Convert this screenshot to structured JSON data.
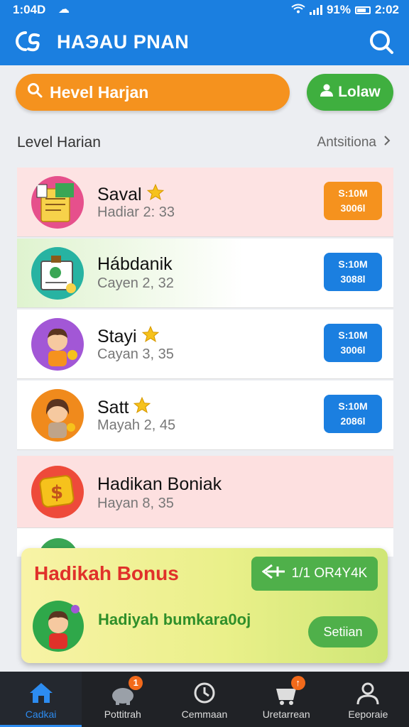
{
  "status_bar": {
    "time": "1:04D",
    "right": "91%",
    "clock": "2:02"
  },
  "app": {
    "title": "HAЭAU PNAN"
  },
  "search": {
    "label": "Hevel Harjan"
  },
  "follow": {
    "label": "Lolaw"
  },
  "section": {
    "title": "Level Harian",
    "link": "Antsitiona"
  },
  "list": [
    {
      "name": "Saval",
      "sub": "Hadiar 2: 33",
      "badge_top": "S:10M",
      "badge_bottom": "3006l",
      "badge_color": "#f5921e",
      "bg": "#fde3e3",
      "star": true
    },
    {
      "name": "Hábdanik",
      "sub": "Cayen 2, 32",
      "badge_top": "S:10M",
      "badge_bottom": "3088l",
      "badge_color": "#1b7fe0",
      "bg": "linear-gradient(90deg,#dff3cf 0%,#ffffff 60%)",
      "star": false
    },
    {
      "name": "Stayi",
      "sub": "Cayan 3, 35",
      "badge_top": "S:10M",
      "badge_bottom": "3006l",
      "badge_color": "#1b7fe0",
      "bg": "#ffffff",
      "star": true
    },
    {
      "name": "Satt",
      "sub": "Mayah 2, 45",
      "badge_top": "S:10M",
      "badge_bottom": "2086l",
      "badge_color": "#1b7fe0",
      "bg": "#ffffff",
      "star": true
    },
    {
      "name": "Hadikan Boniak",
      "sub": "Hayan 8, 35",
      "bg": "#fde0e0",
      "star": false
    }
  ],
  "bonus": {
    "title": "Hadikah Bonus",
    "code": "1/1 OR4Y4K",
    "text": "Hadiyah bumkara0oj",
    "button": "Setiian"
  },
  "bottom_nav": [
    {
      "label": "Cadkai",
      "active": true
    },
    {
      "label": "Pottitrah",
      "badge": "1"
    },
    {
      "label": "Cemmaan"
    },
    {
      "label": "Uretarrean",
      "badge": "↑"
    },
    {
      "label": "Eeporaie"
    }
  ],
  "colors": {
    "primary": "#1b7fe0",
    "orange": "#f5921e",
    "green": "#4fb04a",
    "bonus_red": "#e0312a"
  }
}
